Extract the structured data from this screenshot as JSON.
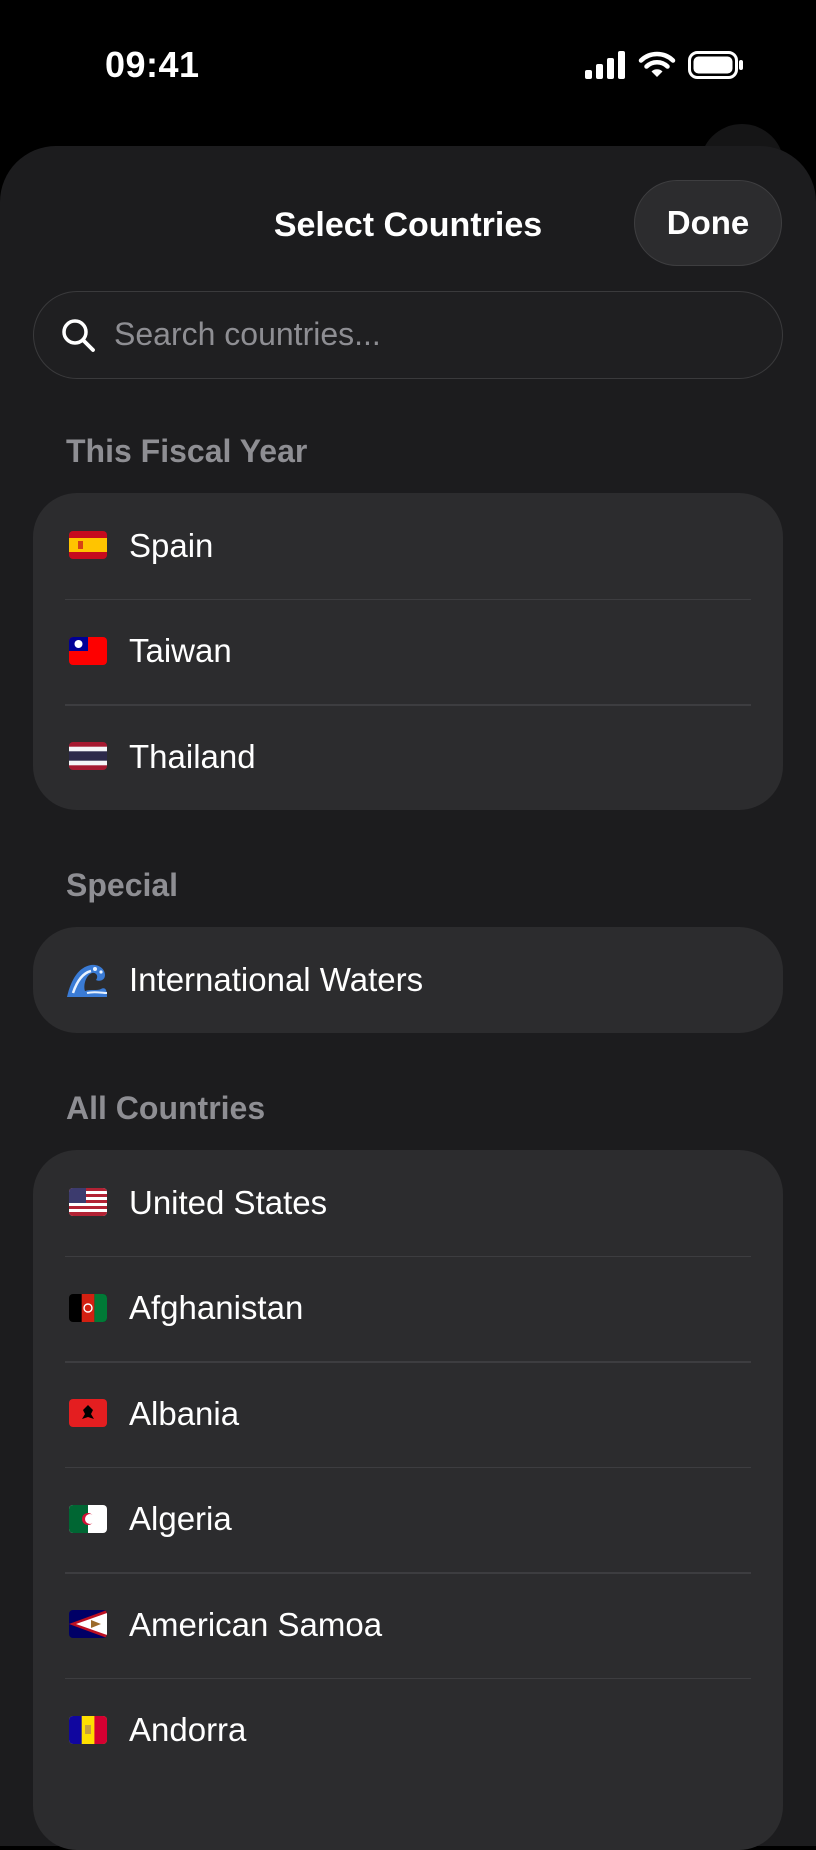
{
  "status_bar": {
    "time": "09:41",
    "icons": [
      "cellular-signal-icon",
      "wifi-icon",
      "battery-icon"
    ]
  },
  "sheet": {
    "title": "Select Countries",
    "done_label": "Done"
  },
  "search": {
    "placeholder": "Search countries...",
    "value": ""
  },
  "sections": [
    {
      "header": "This Fiscal Year",
      "items": [
        {
          "label": "Spain",
          "flag": "spain-flag-icon"
        },
        {
          "label": "Taiwan",
          "flag": "taiwan-flag-icon"
        },
        {
          "label": "Thailand",
          "flag": "thailand-flag-icon"
        }
      ]
    },
    {
      "header": "Special",
      "items": [
        {
          "label": "International Waters",
          "flag": "wave-icon"
        }
      ]
    },
    {
      "header": "All Countries",
      "items": [
        {
          "label": "United States",
          "flag": "united-states-flag-icon"
        },
        {
          "label": "Afghanistan",
          "flag": "afghanistan-flag-icon"
        },
        {
          "label": "Albania",
          "flag": "albania-flag-icon"
        },
        {
          "label": "Algeria",
          "flag": "algeria-flag-icon"
        },
        {
          "label": "American Samoa",
          "flag": "american-samoa-flag-icon"
        },
        {
          "label": "Andorra",
          "flag": "andorra-flag-icon"
        }
      ]
    }
  ],
  "colors": {
    "background": "#000000",
    "sheet": "#1c1c1e",
    "group": "#2c2c2e",
    "secondary_text": "#8e8e93"
  }
}
